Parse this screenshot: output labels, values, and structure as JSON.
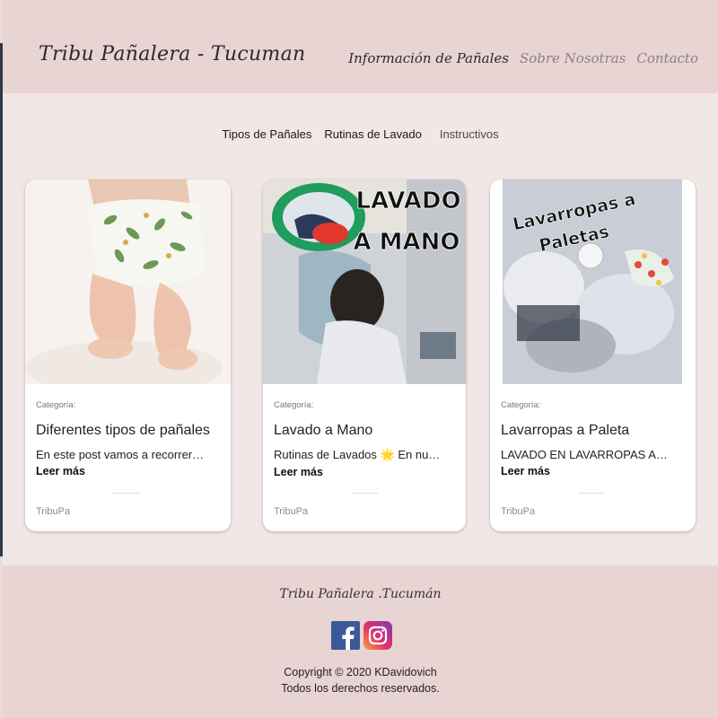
{
  "header": {
    "brand": "Tribu Pañalera - Tucuman",
    "nav": [
      {
        "label": "Información de Pañales",
        "active": true
      },
      {
        "label": "Sobre Nosotras",
        "active": false
      },
      {
        "label": "Contacto",
        "active": false
      }
    ]
  },
  "subnav": [
    "Tipos de Pañales",
    "Rutinas de Lavado",
    "Instructivos"
  ],
  "cards": [
    {
      "image_icon": "baby-cloth-diaper-photo",
      "category": "Categoría:",
      "title": "Diferentes tipos de pañales",
      "excerpt": "En este post vamos a recorrer…",
      "more": "Leer más",
      "author": "TribuPa"
    },
    {
      "image_icon": "hand-washing-photo",
      "image_text": [
        "LAVADO",
        "A MANO"
      ],
      "category": "Categoría:",
      "title": "Lavado a Mano",
      "excerpt": "Rutinas de Lavados 🌟 En nu…",
      "more": "Leer más",
      "author": "TribuPa"
    },
    {
      "image_icon": "washing-machine-laundry-photo",
      "image_text": [
        "Lavarropas a",
        "Paletas"
      ],
      "category": "Categoría:",
      "title": "Lavarropas a Paleta",
      "excerpt": "LAVADO EN LAVARROPAS A…",
      "more": "Leer más",
      "author": "TribuPa"
    }
  ],
  "footer": {
    "brand": "Tribu Pañalera .Tucumán",
    "social": [
      "facebook-icon",
      "instagram-icon"
    ],
    "copyright": "Copyright © 2020 KDavidovich",
    "rights": "Todos los derechos reservados."
  },
  "colors": {
    "header_bg": "#e8d4d2",
    "main_bg": "#f1e7e6",
    "facebook": "#3b5998"
  }
}
